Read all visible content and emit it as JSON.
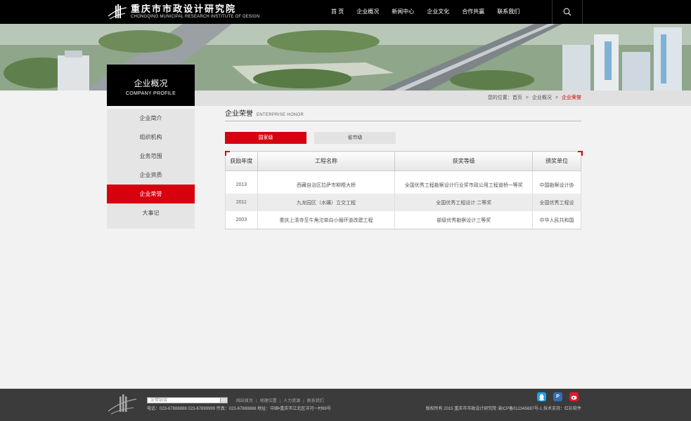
{
  "header": {
    "logo_cn": "重庆市市政设计研究院",
    "logo_en": "CHONGQING MUNICIPAL RESEARCH INSTITUTE OF DESIGN",
    "nav": [
      "首 页",
      "企业概况",
      "新闻中心",
      "企业文化",
      "合作共赢",
      "联系我们"
    ],
    "search_icon": "search-icon"
  },
  "sidebar": {
    "title_cn": "企业概况",
    "title_en": "COMPANY PROFILE",
    "items": [
      "企业简介",
      "组织机构",
      "业务范围",
      "企业资质",
      "企业荣誉",
      "大事记"
    ],
    "active_index": 4
  },
  "breadcrumb": {
    "prefix": "您的位置：",
    "items": [
      "首页",
      "企业概况",
      "企业荣誉"
    ],
    "separator": ">"
  },
  "section": {
    "title": "企业荣誉",
    "subtitle": "ENTERPRISE HONOR"
  },
  "tabs": [
    "国家级",
    "省市级"
  ],
  "table": {
    "headers": [
      "获励年度",
      "工程名称",
      "获奖等级",
      "颁奖单位"
    ],
    "rows": [
      [
        "2013",
        "西藏自治区拉萨市柳梧大桥",
        "全国优秀工程勘察设计行业奖市政公用工程道桥一等奖",
        "中国勘察设计协"
      ],
      [
        "2011",
        "九龙园区（水碾）立交工程",
        "全国优秀工程设计 二等奖",
        "全国优秀工程设"
      ],
      [
        "2003",
        "重庆上清寺至牛角沱单向小循环道改建工程",
        "部级优秀勘察设计三等奖",
        "中华人民共和国"
      ]
    ]
  },
  "footer": {
    "select_placeholder": "友情链接",
    "links": [
      "网站首页",
      "地理位置",
      "人力资源",
      "联系我们"
    ],
    "contact": "电话：023-67888888 023-67899999 传真：023-67888888 地址：中国•重庆市江北区洋河一村69号",
    "copyright": "版权所有 2015 重庆市市政设计研究院 渝ICP备012345687号-1 技术支持：红衫软件",
    "social": [
      "qq-icon",
      "qzone-icon",
      "weibo-icon"
    ]
  },
  "colors": {
    "accent": "#d7000f",
    "topbar": "#000000",
    "footer": "#3b3b3b"
  }
}
